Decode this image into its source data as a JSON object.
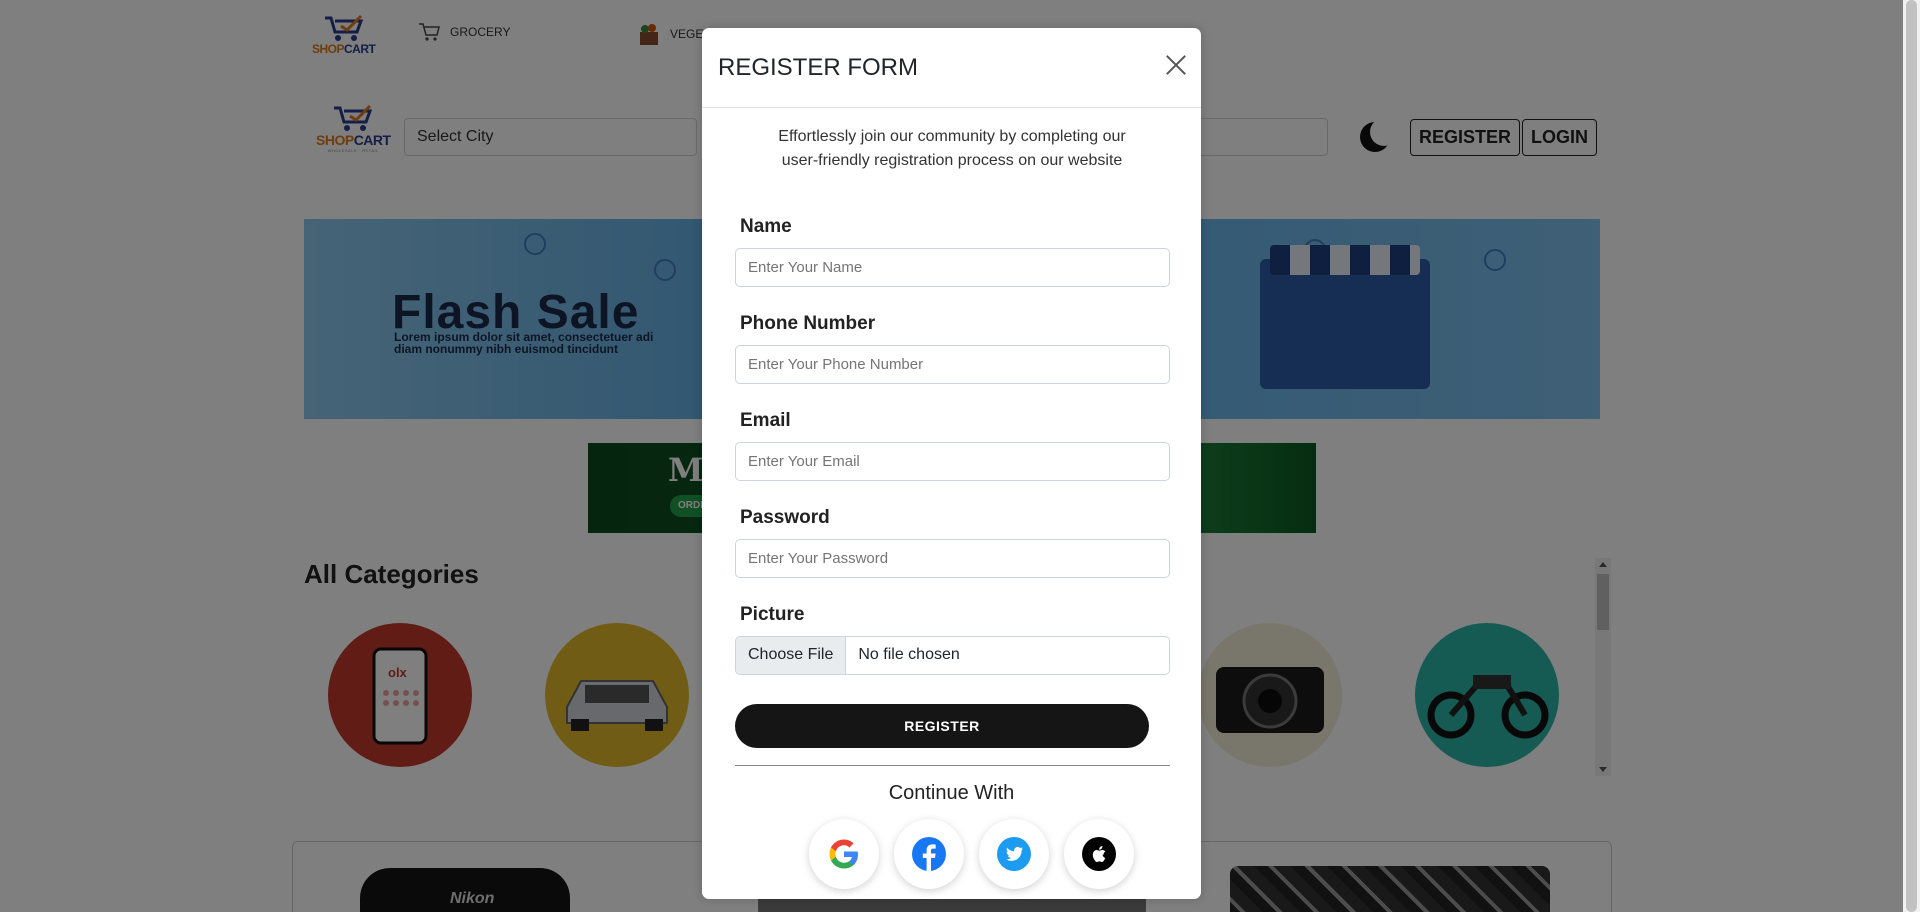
{
  "header": {
    "logo_word_a": "SHOP",
    "logo_word_b": "CART",
    "logo_tag": "WHOLESALE · RETAIL",
    "nav_items": [
      {
        "label": "GROCERY",
        "icon": "cart-icon"
      },
      {
        "label": "VEGET",
        "icon": "vegetable-basket-icon"
      }
    ],
    "city_select": "Select City",
    "register_label": "REGISTER",
    "login_label": "LOGIN",
    "theme_icon": "moon-icon"
  },
  "banner": {
    "title": "Flash Sale",
    "lorem_line1": "Lorem ipsum dolor sit amet, consectetuer adi",
    "lorem_line2": "diam nonummy nibh euismod tincidunt"
  },
  "promo": {
    "title": "Mi",
    "order_label": "ORDE"
  },
  "categories": {
    "title": "All Categories",
    "items": [
      {
        "name": "mobile",
        "color": "#c0392b"
      },
      {
        "name": "car",
        "color": "#e3b82a"
      },
      {
        "name": "camera",
        "color": "#f3ecd8"
      },
      {
        "name": "motorcycle",
        "color": "#2bb7a8"
      }
    ]
  },
  "products": {
    "camera_brand": "Nikon"
  },
  "modal": {
    "title": "REGISTER FORM",
    "intro": "Effortlessly join our community by completing our user-friendly registration process on our website",
    "fields": {
      "name": {
        "label": "Name",
        "placeholder": "Enter Your Name"
      },
      "phone": {
        "label": "Phone Number",
        "placeholder": "Enter Your Phone Number"
      },
      "email": {
        "label": "Email",
        "placeholder": "Enter Your Email"
      },
      "password": {
        "label": "Password",
        "placeholder": "Enter Your Password"
      },
      "picture": {
        "label": "Picture",
        "button": "Choose File",
        "status": "No file chosen"
      }
    },
    "submit_label": "REGISTER",
    "continue_label": "Continue With",
    "social": [
      "google-icon",
      "facebook-icon",
      "twitter-icon",
      "apple-icon"
    ],
    "colors": {
      "facebook": "#1877f2",
      "twitter": "#1d9bf0",
      "apple": "#000000",
      "submit": "#151515"
    }
  }
}
